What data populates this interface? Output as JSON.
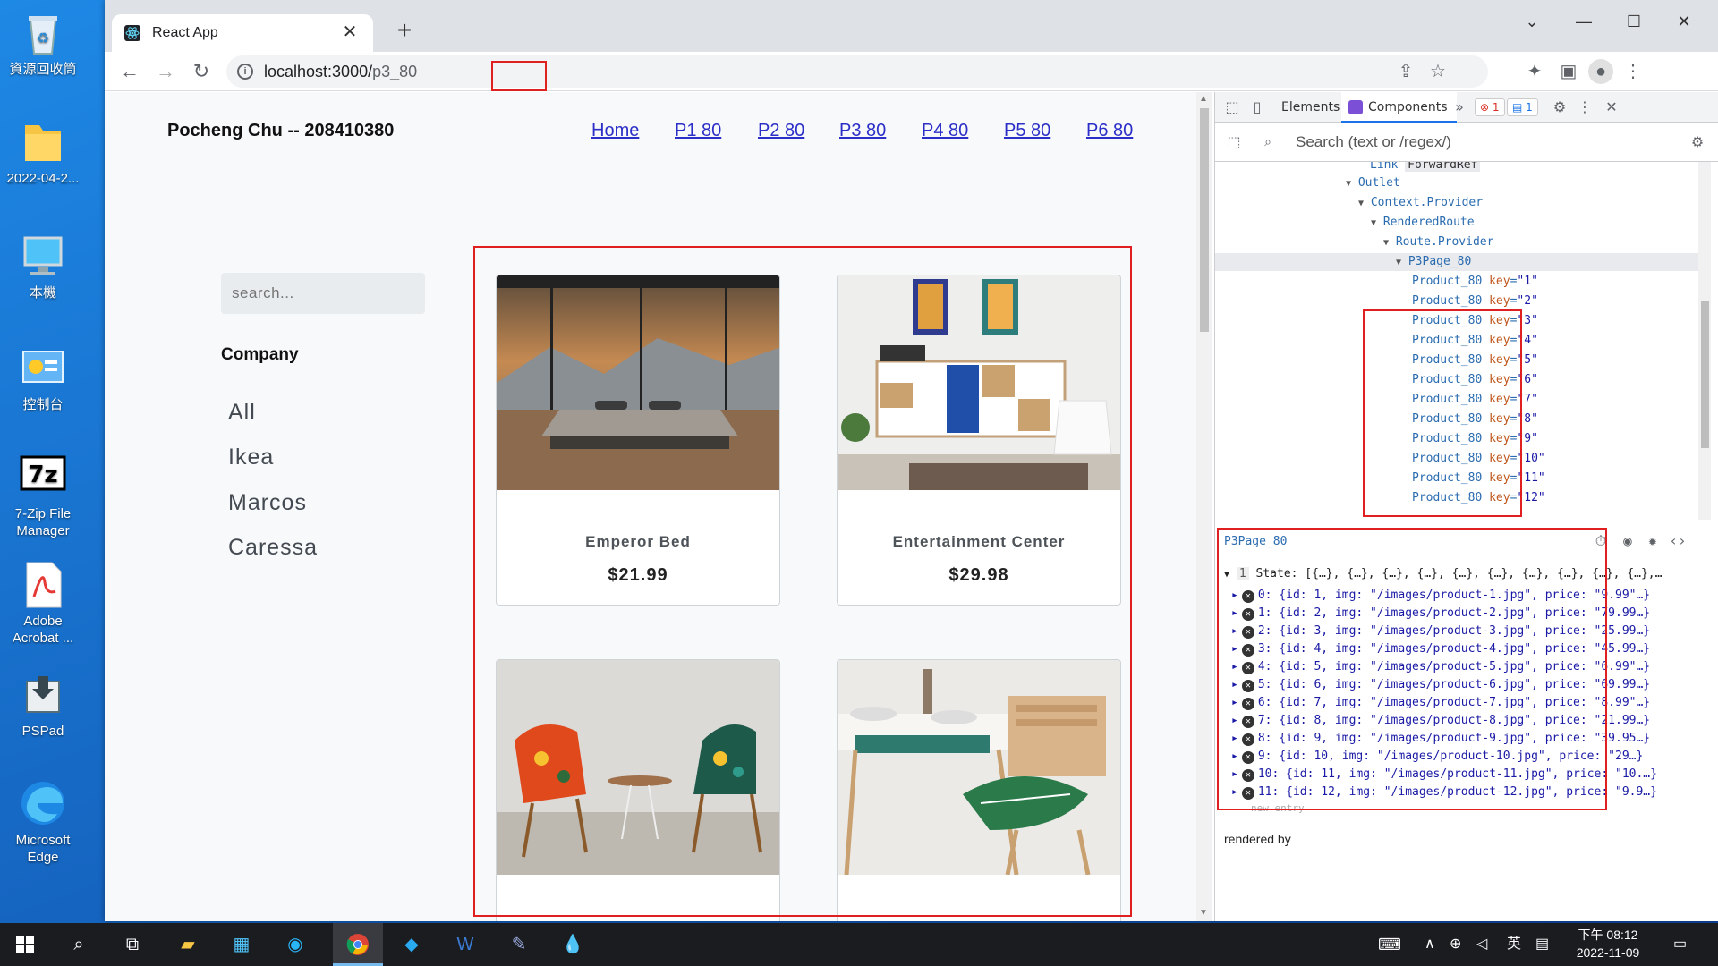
{
  "desktop": {
    "icons": [
      {
        "label": "資源回收筒",
        "icon": "recycle-bin-icon"
      },
      {
        "label": "2022-04-2...",
        "icon": "folder-icon"
      },
      {
        "label": "本機",
        "icon": "computer-icon"
      },
      {
        "label": "控制台",
        "icon": "control-panel-icon"
      },
      {
        "label": "7-Zip File Manager",
        "icon": "7zip-icon"
      },
      {
        "label": "Adobe Acrobat ...",
        "icon": "acrobat-icon"
      },
      {
        "label": "PSPad",
        "icon": "pspad-icon"
      },
      {
        "label": "Microsoft Edge",
        "icon": "edge-icon"
      }
    ]
  },
  "browser": {
    "tab_title": "React App",
    "url_host": "localhost:3000/",
    "url_path": "p3_80"
  },
  "page": {
    "brand": "Pocheng Chu -- 208410380",
    "nav": [
      "Home",
      "P1 80",
      "P2 80",
      "P3 80",
      "P4 80",
      "P5 80",
      "P6 80"
    ],
    "search_placeholder": "search...",
    "company_heading": "Company",
    "companies": [
      "All",
      "Ikea",
      "Marcos",
      "Caressa"
    ],
    "products": [
      {
        "name": "Emperor Bed",
        "price": "$21.99"
      },
      {
        "name": "Entertainment Center",
        "price": "$29.98"
      },
      {
        "name": "",
        "price": ""
      },
      {
        "name": "",
        "price": ""
      }
    ]
  },
  "devtools": {
    "tabs": [
      "Elements",
      "Components"
    ],
    "error_count": "1",
    "message_count": "1",
    "search_placeholder": "Search (text or /regex/)",
    "tree": [
      {
        "text": "Link",
        "extra": "ForwardRef"
      },
      {
        "text": "Outlet"
      },
      {
        "text": "Context.Provider"
      },
      {
        "text": "RenderedRoute"
      },
      {
        "text": "Route.Provider"
      },
      {
        "text": "P3Page_80"
      }
    ],
    "product_nodes": [
      {
        "name": "Product_80",
        "key": "\"1\""
      },
      {
        "name": "Product_80",
        "key": "\"2\""
      },
      {
        "name": "Product_80",
        "key": "\"3\""
      },
      {
        "name": "Product_80",
        "key": "\"4\""
      },
      {
        "name": "Product_80",
        "key": "\"5\""
      },
      {
        "name": "Product_80",
        "key": "\"6\""
      },
      {
        "name": "Product_80",
        "key": "\"7\""
      },
      {
        "name": "Product_80",
        "key": "\"8\""
      },
      {
        "name": "Product_80",
        "key": "\"9\""
      },
      {
        "name": "Product_80",
        "key": "\"10\""
      },
      {
        "name": "Product_80",
        "key": "\"11\""
      },
      {
        "name": "Product_80",
        "key": "\"12\""
      }
    ],
    "selected_component": "P3Page_80",
    "state_header": "State: [{…}, {…}, {…}, {…}, {…}, {…}, {…}, {…}, {…}, {…},…",
    "state_rows": [
      "0: {id: 1, img: \"/images/product-1.jpg\", price: \"9.99\"…}",
      "1: {id: 2, img: \"/images/product-2.jpg\", price: \"79.99…}",
      "2: {id: 3, img: \"/images/product-3.jpg\", price: \"25.99…}",
      "3: {id: 4, img: \"/images/product-4.jpg\", price: \"45.99…}",
      "4: {id: 5, img: \"/images/product-5.jpg\", price: \"6.99\"…}",
      "5: {id: 6, img: \"/images/product-6.jpg\", price: \"69.99…}",
      "6: {id: 7, img: \"/images/product-7.jpg\", price: \"8.99\"…}",
      "7: {id: 8, img: \"/images/product-8.jpg\", price: \"21.99…}",
      "8: {id: 9, img: \"/images/product-9.jpg\", price: \"39.95…}",
      "9: {id: 10, img: \"/images/product-10.jpg\", price: \"29…}",
      "10: {id: 11, img: \"/images/product-11.jpg\", price: \"10.…}",
      "11: {id: 12, img: \"/images/product-12.jpg\", price: \"9.9…}"
    ],
    "new_entry": "new entry",
    "rendered_by": "rendered by"
  },
  "taskbar": {
    "time": "下午 08:12",
    "date": "2022-11-09",
    "ime": "英"
  }
}
